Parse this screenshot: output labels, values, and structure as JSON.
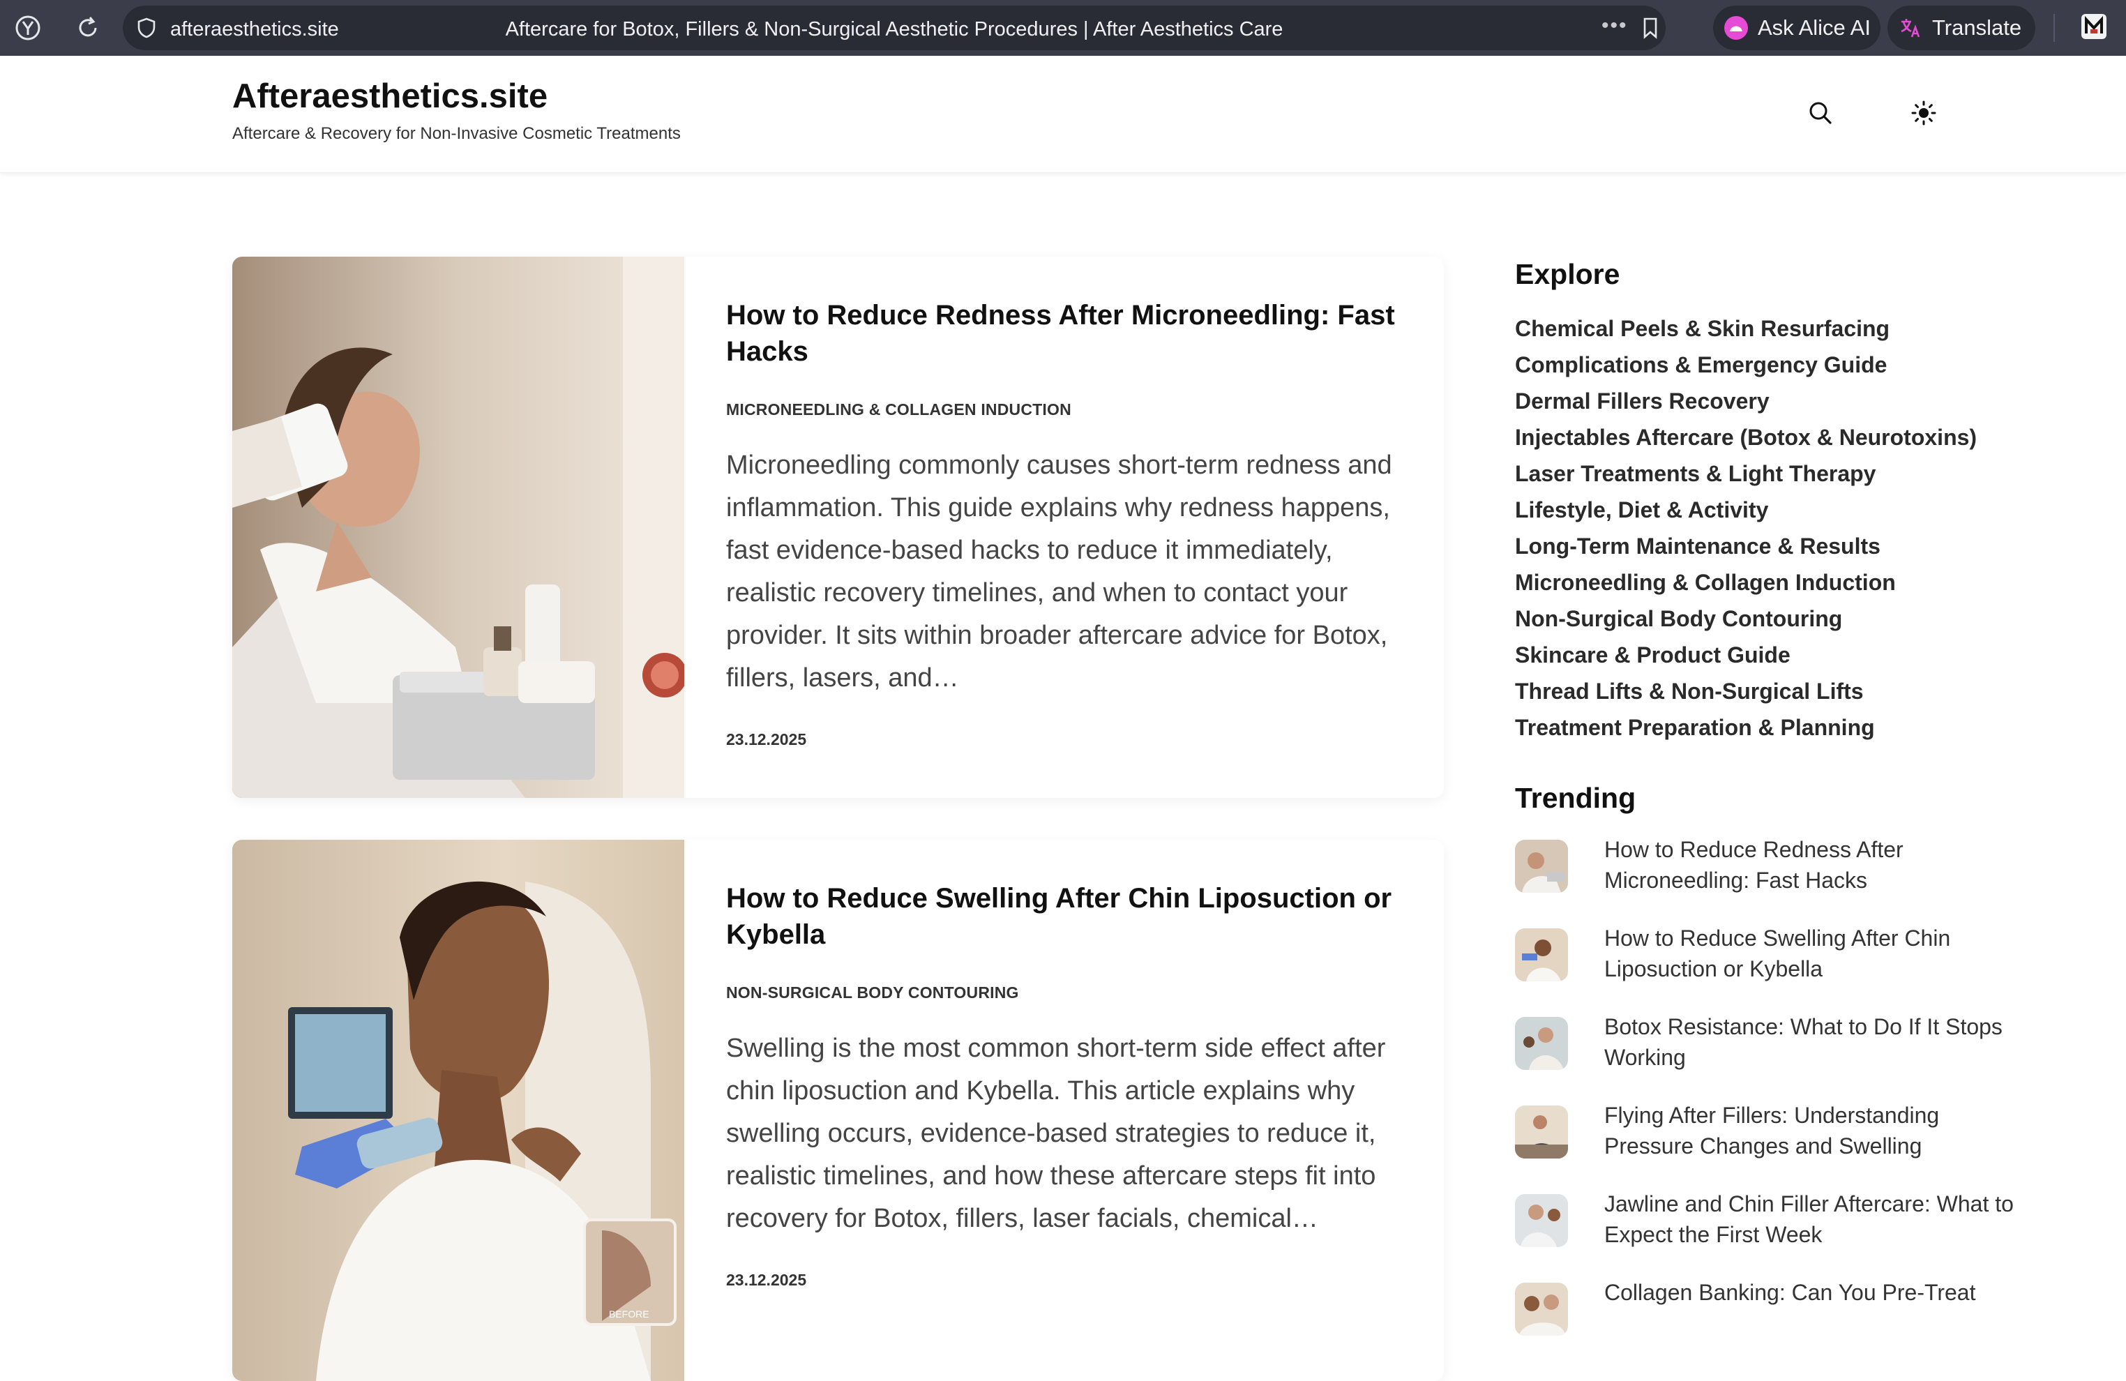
{
  "browser": {
    "url_domain": "afteraesthetics.site",
    "page_title": "Aftercare for Botox, Fillers & Non-Surgical Aesthetic Procedures | After Aesthetics Care",
    "more_label": "•••",
    "ask_alice_label": "Ask Alice AI",
    "translate_label": "Translate"
  },
  "site": {
    "title": "Afteraesthetics.site",
    "tagline": "Aftercare & Recovery for Non-Invasive Cosmetic Treatments"
  },
  "articles": [
    {
      "title": "How to Reduce Redness After Microneedling: Fast Hacks",
      "category": "MICRONEEDLING & COLLAGEN INDUCTION",
      "excerpt": "Microneedling commonly causes short-term redness and inflammation. This guide explains why redness happens, fast evidence-based hacks to reduce it immediately, realistic recovery timelines, and when to contact your provider. It sits within broader aftercare advice for Botox, fillers, lasers, and…",
      "date": "23.12.2025",
      "image_icon": "woman-skincare-photo"
    },
    {
      "title": "How to Reduce Swelling After Chin Liposuction or Kybella",
      "category": "NON-SURGICAL BODY CONTOURING",
      "excerpt": "Swelling is the most common short-term side effect after chin liposuction and Kybella. This article explains why swelling occurs, evidence-based strategies to reduce it, realistic timelines, and how these aftercare steps fit into recovery for Botox, fillers, laser facials, chemical…",
      "date": "23.12.2025",
      "image_icon": "woman-chin-treatment-photo",
      "image_badge": "BEFORE"
    }
  ],
  "sidebar": {
    "explore_heading": "Explore",
    "explore_items": [
      "Chemical Peels & Skin Resurfacing",
      "Complications & Emergency Guide",
      "Dermal Fillers Recovery",
      "Injectables Aftercare (Botox & Neurotoxins)",
      "Laser Treatments & Light Therapy",
      "Lifestyle, Diet & Activity",
      "Long-Term Maintenance & Results",
      "Microneedling & Collagen Induction",
      "Non-Surgical Body Contouring",
      "Skincare & Product Guide",
      "Thread Lifts & Non-Surgical Lifts",
      "Treatment Preparation & Planning"
    ],
    "trending_heading": "Trending",
    "trending_items": [
      "How to Reduce Redness After Microneedling: Fast Hacks",
      "How to Reduce Swelling After Chin Liposuction or Kybella",
      "Botox Resistance: What to Do If It Stops Working",
      "Flying After Fillers: Understanding Pressure Changes and Swelling",
      "Jawline and Chin Filler Aftercare: What to Expect the First Week",
      "Collagen Banking: Can You Pre-Treat"
    ]
  },
  "icons": {
    "browser_logo": "yandex-logo-icon",
    "reload": "reload-icon",
    "shield": "shield-icon",
    "bookmark": "bookmark-icon",
    "alice": "alice-icon",
    "translate": "translate-icon",
    "extension": "extension-icon",
    "search": "search-icon",
    "theme": "sun-icon"
  },
  "colors": {
    "chrome_bg": "#3b3e4a",
    "urlbar_bg": "#2a2c35",
    "page_bg": "#ffffff",
    "text_dark": "#111111",
    "alice_accent": "#e64bd6"
  }
}
